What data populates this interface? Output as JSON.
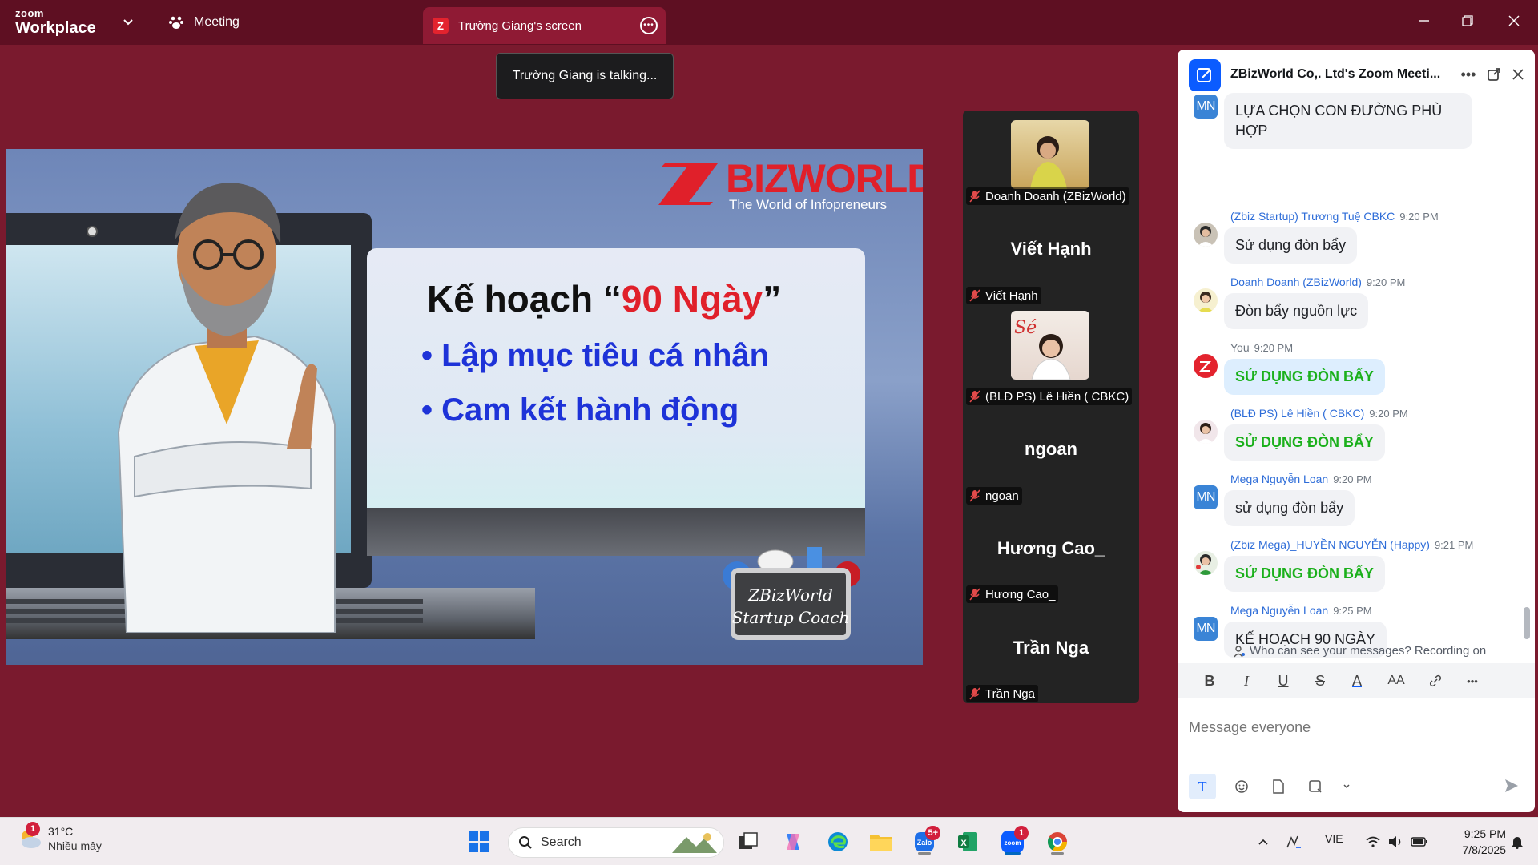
{
  "app": {
    "brand_small": "zoom",
    "brand_big": "Workplace",
    "meeting_tab": "Meeting",
    "screen_tab": "Trường Giang's screen",
    "talking_toast": "Trường Giang is talking..."
  },
  "slide": {
    "brand_word": "BIZWORLD",
    "brand_tagline": "The World of Infopreneurs",
    "title_prefix": "Kế hoạch “",
    "title_accent": "90 Ngày",
    "title_suffix": "”",
    "bullets": [
      "• Lập mục tiêu cá nhân",
      "• Cam kết hành động"
    ],
    "coach_line1": "ZBizWorld",
    "coach_line2": "Startup Coach",
    "accent_color": "#e0202a",
    "bullet_color": "#1e33d8"
  },
  "participants": [
    {
      "name": "Doanh Doanh (ZBizWorld)",
      "has_video": true
    },
    {
      "name": "Viết Hạnh",
      "display": "Viết Hạnh",
      "has_video": false
    },
    {
      "name": "(BLĐ PS) Lê Hiền ( CBKC)",
      "has_video": true
    },
    {
      "name": "ngoan",
      "display": "ngoan",
      "has_video": false
    },
    {
      "name": "Hương Cao_",
      "display": "Hương Cao_",
      "has_video": false
    },
    {
      "name": "Trần Nga",
      "display": "Trần Nga",
      "has_video": false
    }
  ],
  "chat": {
    "title": "ZBizWorld Co,. Ltd's Zoom Meeti...",
    "messages": [
      {
        "sender": "",
        "time": "",
        "avatar": "MN",
        "text_line1": "LỰA CHỌN CON ĐƯỜNG PHÙ",
        "text_line2": "HỢP"
      },
      {
        "sender": "(Zbiz Startup) Trương Tuệ CBKC",
        "time": "9:20 PM",
        "text": "Sử dụng đòn bẩy"
      },
      {
        "sender": "Doanh Doanh (ZBizWorld)",
        "time": "9:20 PM",
        "text": "Đòn bẩy nguồn lực"
      },
      {
        "sender": "You",
        "time": "9:20 PM",
        "text": "SỬ DỤNG ĐÒN BẨY"
      },
      {
        "sender": "(BLĐ PS) Lê Hiền ( CBKC)",
        "time": "9:20 PM",
        "text": "SỬ DỤNG ĐÒN BẨY"
      },
      {
        "sender": "Mega Nguyễn Loan",
        "time": "9:20 PM",
        "avatar": "MN",
        "text": "sử dụng đòn bẩy"
      },
      {
        "sender": "(Zbiz Mega)_HUYỀN NGUYỄN (Happy)",
        "time": "9:21 PM",
        "text": "SỬ DỤNG ĐÒN BẨY"
      },
      {
        "sender": "Mega Nguyễn Loan",
        "time": "9:25 PM",
        "avatar": "MN",
        "text": "KẾ HOẠCH 90 NGÀY"
      }
    ],
    "privacy_notice": "Who can see your messages? Recording on",
    "input_placeholder": "Message everyone",
    "highlight_color": "#1bb01b"
  },
  "taskbar": {
    "weather_temp": "31°C",
    "weather_cond": "Nhiều mây",
    "weather_badge": "1",
    "search_label": "Search",
    "zalo_badge": "5+",
    "zoom_badge": "1",
    "language": "VIE",
    "time": "9:25 PM",
    "date": "7/8/2025"
  }
}
